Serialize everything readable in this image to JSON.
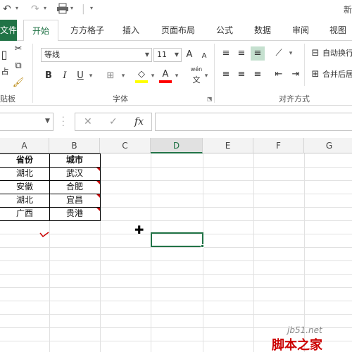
{
  "window": {
    "title_partial": "新"
  },
  "ribbon_tabs": [
    "文件",
    "开始",
    "方方格子",
    "插入",
    "页面布局",
    "公式",
    "数据",
    "审阅",
    "视图"
  ],
  "ribbon": {
    "font_name": "等线",
    "font_size": "11",
    "groups": {
      "clipboard": "贴板",
      "font": "字体",
      "alignment": "对齐方式"
    },
    "clipboard_paste_fragment": "占",
    "bold": "B",
    "italic": "I",
    "underline": "U",
    "font_color_letter": "A",
    "wen_label": "wén",
    "wen_char": "文",
    "grow_font": "A",
    "shrink_font": "A",
    "wrap_text": "自动换行",
    "merge_center": "合并后居中",
    "colors": {
      "highlight": "#ffff00",
      "font_color": "#ff0000",
      "accent": "#217346"
    }
  },
  "formula_bar": {
    "name_box": "",
    "cancel_icon": "✕",
    "enter_icon": "✓",
    "fx_label": "fx",
    "formula": ""
  },
  "sheet": {
    "columns": [
      "A",
      "B",
      "C",
      "D",
      "E",
      "F",
      "G"
    ],
    "selected_column": "D",
    "table": {
      "headers": [
        "省份",
        "城市"
      ],
      "rows": [
        [
          "湖北",
          "武汉"
        ],
        [
          "安徽",
          "合肥"
        ],
        [
          "湖北",
          "宜昌"
        ],
        [
          "广西",
          "贵港"
        ]
      ]
    }
  },
  "watermark": {
    "url": "jb51.net",
    "site_name": "脚本之家"
  }
}
